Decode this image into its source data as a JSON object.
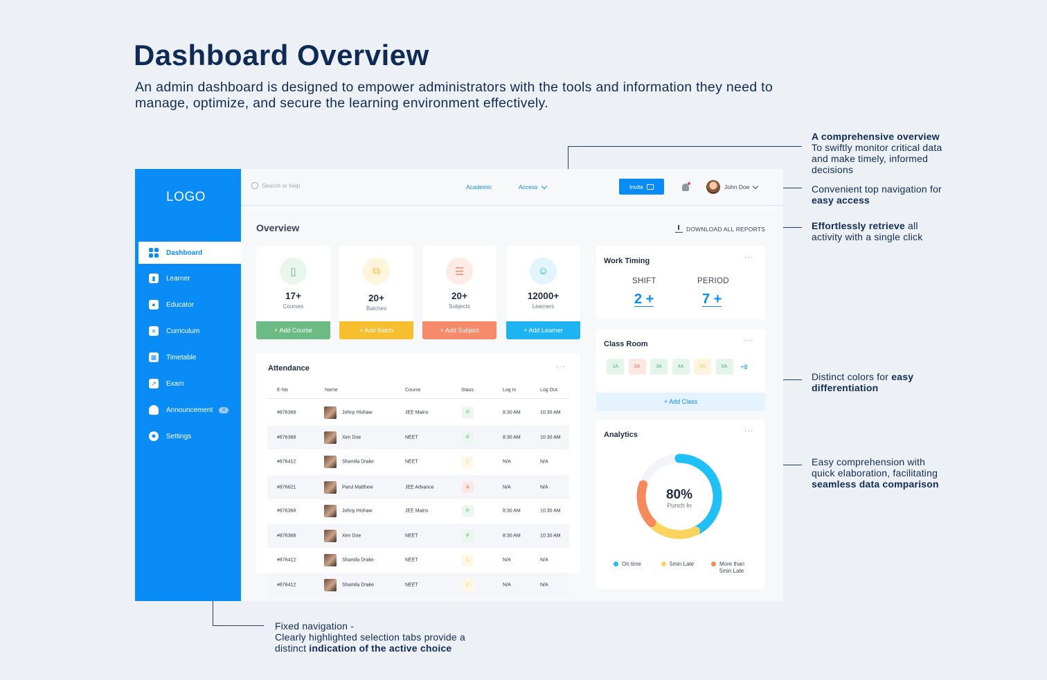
{
  "heading": {
    "title": "Dashboard Overview",
    "subtitle": "An admin dashboard is designed to empower administrators with the tools and information they need to manage, optimize, and secure the learning environment effectively."
  },
  "annotations": {
    "overview": {
      "bold": "A comprehensive overview",
      "text": "To swiftly monitor critical data and make timely, informed decisions"
    },
    "topnav": {
      "text": "Convenient top navigation for ",
      "bold": "easy access"
    },
    "retrieve": {
      "bold": "Effortlessly retrieve",
      "text": " all activity with a single click"
    },
    "colors": {
      "text": "Distinct colors for ",
      "bold1": "easy",
      "bold2": "differentiation"
    },
    "analytics": {
      "text": "Easy comprehension with quick elaboration, facilitating ",
      "bold": "seamless data comparison"
    },
    "fixednav": {
      "line1": "Fixed navigation -",
      "line2": "Clearly highlighted selection tabs provide a",
      "line3": "distinct ",
      "bold": "indication of the active choice"
    }
  },
  "sidebar": {
    "logo": "LOGO",
    "items": [
      {
        "label": "Dashboard",
        "icon": "grid-icon"
      },
      {
        "label": "Learner",
        "icon": "chart-icon"
      },
      {
        "label": "Educator",
        "icon": "people-icon"
      },
      {
        "label": "Curriculum",
        "icon": "document-icon"
      },
      {
        "label": "Timetable",
        "icon": "calendar-icon"
      },
      {
        "label": "Exam",
        "icon": "exam-icon"
      },
      {
        "label": "Announcement",
        "icon": "bell-icon",
        "badge": "4"
      },
      {
        "label": "Settings",
        "icon": "gear-icon"
      }
    ]
  },
  "topbar": {
    "search_placeholder": "Search or help",
    "academic": "Academic",
    "access": "Access",
    "invite": "Invite",
    "user": "John Doe"
  },
  "overview": {
    "title": "Overview",
    "download": "DOWNLOAD ALL REPORTS"
  },
  "stats": [
    {
      "value": "17+",
      "label": "Courses",
      "button": "+ Add Course",
      "color": "#6cbb85",
      "tint": "#e9f6ee",
      "icon": "book-icon"
    },
    {
      "value": "20+",
      "label": "Batches",
      "button": "+ Add Batch",
      "color": "#f7be2f",
      "tint": "#fff4dc",
      "icon": "batch-icon"
    },
    {
      "value": "20+",
      "label": "Subjects",
      "button": "+ Add Subject",
      "color": "#f68a6b",
      "tint": "#fdebe5",
      "icon": "subject-icon"
    },
    {
      "value": "12000+",
      "label": "Learners",
      "button": "+ Add Learner",
      "color": "#1eb4f4",
      "tint": "#e2f4fd",
      "icon": "learner-icon"
    }
  ],
  "attendance": {
    "title": "Attendance",
    "columns": [
      "E-No",
      "Name",
      "Course",
      "Staus",
      "Log In",
      "Log Out"
    ],
    "rows": [
      {
        "eno": "#876368",
        "name": "Johny Hishaw",
        "course": "JEE Mains",
        "status": "P",
        "login": "8:30 AM",
        "logout": "10:30 AM"
      },
      {
        "eno": "#876368",
        "name": "Xen Doe",
        "course": "NEET",
        "status": "P",
        "login": "8:30 AM",
        "logout": "10:30 AM"
      },
      {
        "eno": "#876412",
        "name": "Shamila Drake",
        "course": "NEET",
        "status": "L",
        "login": "N/A",
        "logout": "N/A"
      },
      {
        "eno": "#876621",
        "name": "Parul Matthew",
        "course": "JEE Advance",
        "status": "A",
        "login": "N/A",
        "logout": "N/A"
      },
      {
        "eno": "#876368",
        "name": "Johny Hishaw",
        "course": "JEE Mains",
        "status": "P",
        "login": "8:30 AM",
        "logout": "10:30 AM"
      },
      {
        "eno": "#876368",
        "name": "Xen Doe",
        "course": "NEET",
        "status": "P",
        "login": "8:30 AM",
        "logout": "10:30 AM"
      },
      {
        "eno": "#876412",
        "name": "Shamila Drake",
        "course": "NEET",
        "status": "L",
        "login": "N/A",
        "logout": "N/A"
      },
      {
        "eno": "#876412",
        "name": "Shamila Drake",
        "course": "NEET",
        "status": "L",
        "login": "N/A",
        "logout": "N/A"
      }
    ]
  },
  "work_timing": {
    "title": "Work Timing",
    "shift_label": "SHIFT",
    "shift_value": "2 +",
    "period_label": "PERIOD",
    "period_value": "7 +"
  },
  "classroom": {
    "title": "Class Room",
    "classes": [
      {
        "label": "1A",
        "bg": "#e6f5ec",
        "fg": "#4cb27a"
      },
      {
        "label": "2A",
        "bg": "#fde8e3",
        "fg": "#e5644f"
      },
      {
        "label": "3A",
        "bg": "#e6f5ec",
        "fg": "#4cb27a"
      },
      {
        "label": "4A",
        "bg": "#e6f5ec",
        "fg": "#4cb27a"
      },
      {
        "label": "5A",
        "bg": "#fff5de",
        "fg": "#f6c15a"
      },
      {
        "label": "6A",
        "bg": "#e6f5ec",
        "fg": "#4cb27a"
      }
    ],
    "more": "+8",
    "add": "+ Add Class"
  },
  "analytics": {
    "title": "Analytics",
    "value": "80%",
    "caption": "Punch In",
    "legend": [
      {
        "label": "On time",
        "color": "#1ec0f7"
      },
      {
        "label": "5min Late",
        "color": "#fad45c"
      },
      {
        "label": "More than 5min Late",
        "color": "#f68a5c"
      }
    ],
    "segments": [
      {
        "name": "On time",
        "percent": 43,
        "color": "#1ec0f7"
      },
      {
        "name": "5min Late",
        "percent": 20,
        "color": "#fad45c"
      },
      {
        "name": "More than 5min Late",
        "percent": 17,
        "color": "#f68a5c"
      }
    ]
  }
}
